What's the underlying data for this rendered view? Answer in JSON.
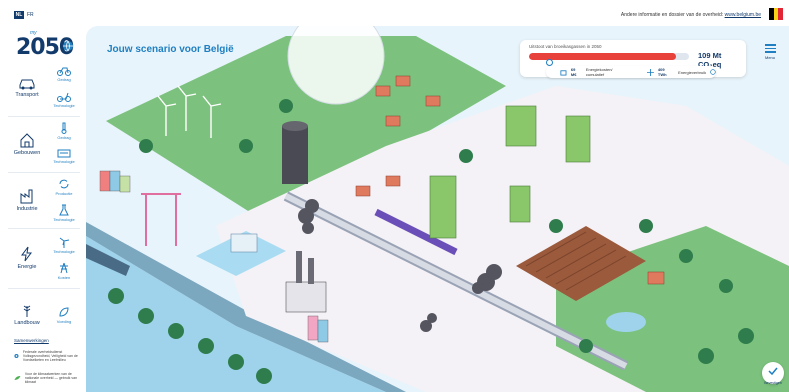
{
  "topbar": {
    "lang_active": "NL",
    "lang_other": "FR",
    "download_text": "Andere informatie en dossier van de overheid:",
    "download_link": "www.belgium.be",
    "flag_colors": [
      "#000000",
      "#f7d117",
      "#e32636"
    ]
  },
  "logo": {
    "prefix": "my",
    "year": "2050"
  },
  "sidebar": {
    "categories": [
      {
        "label": "Transport",
        "icon": "car-icon",
        "subs": [
          {
            "label": "Gedrag",
            "icon": "bicycle-icon"
          },
          {
            "label": "Technologie",
            "icon": "scooter-icon"
          }
        ]
      },
      {
        "label": "Gebouwen",
        "icon": "house-icon",
        "subs": [
          {
            "label": "Gedrag",
            "icon": "thermometer-icon"
          },
          {
            "label": "Technologie",
            "icon": "heat-pump-icon"
          }
        ]
      },
      {
        "label": "Industrie",
        "icon": "factory-icon",
        "subs": [
          {
            "label": "Productie",
            "icon": "recycle-icon"
          },
          {
            "label": "Technologie",
            "icon": "flask-icon"
          }
        ]
      },
      {
        "label": "Energie",
        "icon": "lightning-icon",
        "subs": [
          {
            "label": "Technologie",
            "icon": "wind-turbine-icon"
          },
          {
            "label": "Kosten",
            "icon": "pylon-icon"
          }
        ]
      },
      {
        "label": "Landbouw",
        "icon": "wheat-icon",
        "subs": [
          {
            "label": "Voeding",
            "icon": "leaf-icon"
          }
        ]
      }
    ],
    "partners_label": "Samenwerkingen",
    "partner_1": "Federale overheidsdienst Volksgezondheid, Veiligheid van de Voedselketen en Leefmilieu",
    "partner_2": "Voor de klimaatwerken van de nationale overheid — gebruik van klimaat"
  },
  "main": {
    "title": "Jouw scenario voor België",
    "emissions": {
      "label": "Uitstoot van broeikasgassen in 2050",
      "value": "109 Mt CO₂eq",
      "progress": 0.92,
      "bar_color": "#e8413c"
    },
    "stats": {
      "item1_value": "69 M€",
      "item1_label": "Energiekosten/ cumulatief",
      "item2_value": "409 TWh",
      "item2_label": "Energieverbruik"
    },
    "menu_label": "Menu",
    "validate_label": "Bevestigen"
  }
}
